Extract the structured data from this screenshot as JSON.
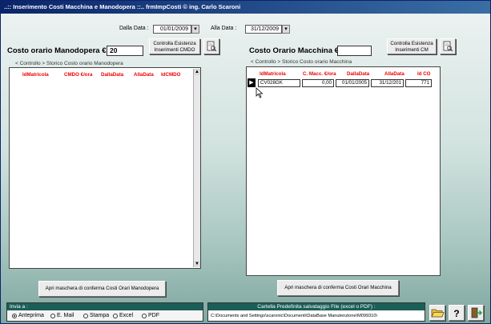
{
  "window": {
    "title": "..:: Inserimento Costi Macchina e Manodopera ::..   frmImpCosti © ing. Carlo Scaroni"
  },
  "filters": {
    "dalla_data_label": "Dalla Data :",
    "dalla_data_value": "01/01/2009",
    "alla_data_label": "Alla Data :",
    "alla_data_value": "31/12/2009"
  },
  "left": {
    "title": "Costo orario Manodopera € :",
    "value": "20",
    "check_button": "Controlla Esistenza Inserimenti CMDO",
    "sublabel": "< Controllo > Storico Costo orario Manodopera",
    "columns": [
      "IdMatricola",
      "CMDO €/ora",
      "DallaData",
      "AllaData",
      "IdCMDO"
    ],
    "rows": [],
    "confirm_button": "Apri maschera di conferma Costi Orari Manodopera"
  },
  "right": {
    "title": "Costo Orario Macchina € :",
    "value": "",
    "check_button": "Controlla Esistenza Inserimenti CM",
    "sublabel": "< Controllo > Storico Costo orario Macchina",
    "columns": [
      "IdMatricola",
      "C. Macc. €/ora",
      "DallaData",
      "AllaData",
      "Id CO"
    ],
    "rows": [
      {
        "matricola": "CV028GK",
        "costo": "0,00",
        "dalla": "01/01/2005",
        "alla": "31/12/201",
        "id": "771"
      }
    ],
    "confirm_button": "Apri maschera di conferma Costi Orari Macchina"
  },
  "bottom": {
    "invia_label": "Invia a :",
    "options": [
      "Anteprima",
      "E. Mail",
      "Stampa",
      "Excel",
      "PDF"
    ],
    "selected": "Anteprima",
    "folder_label": "Cartella Predefinita salvataggio File (excel o PDF) :",
    "folder_path": "C:\\Documents and Settings\\scaronic\\Documenti\\DataBase Manutenzione\\M099310\\"
  },
  "icons": [
    "preview-icon",
    "folder-open-icon",
    "help-icon",
    "exit-icon",
    "dropdown-arrow-icon",
    "scroll-up-icon",
    "scroll-down-icon",
    "record-selector-icon"
  ],
  "colors": {
    "title_bar": "#0a246a",
    "header_text": "#e00000",
    "background_top": "#eef3f2",
    "background_bottom": "#7ea79f"
  }
}
